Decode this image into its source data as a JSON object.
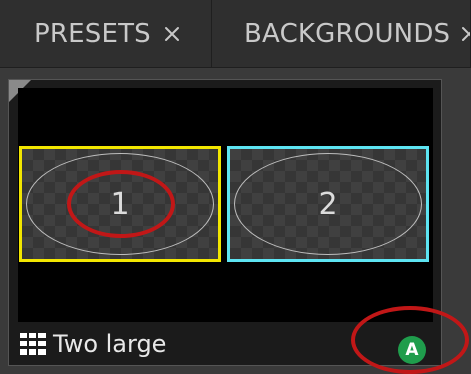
{
  "tabs": [
    {
      "label": "PRESETS",
      "active": true,
      "icon": "close-icon"
    },
    {
      "label": "BACKGROUNDS",
      "active": false,
      "icon": "close-icon"
    }
  ],
  "preset": {
    "name": "Two large",
    "icon": "grid-layout-icon",
    "slot_1_label": "1",
    "slot_2_label": "2",
    "slot_1_color": "#f2e600",
    "slot_2_color": "#5de4f2",
    "badge_label": "A",
    "badge_color": "#1f9d4c"
  },
  "annotations": {
    "color": "#c11717"
  }
}
